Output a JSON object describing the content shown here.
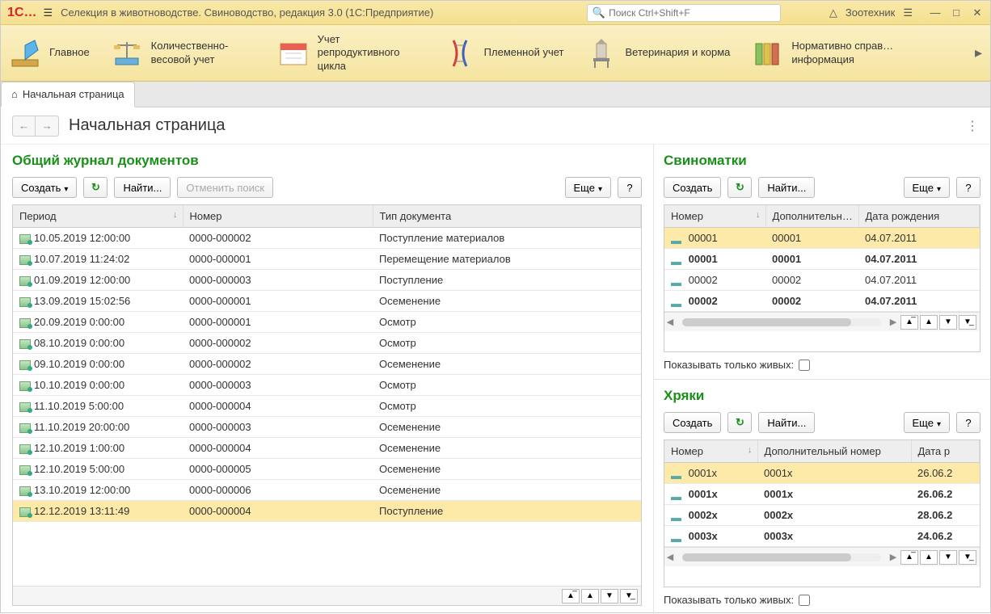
{
  "titlebar": {
    "app_title": "Селекция в животноводстве. Свиноводство, редакция 3.0  (1С:Предприятие)",
    "search_placeholder": "Поиск Ctrl+Shift+F",
    "user": "Зоотехник"
  },
  "nav": {
    "items": [
      {
        "label": "Главное"
      },
      {
        "label": "Количественно-весовой учет"
      },
      {
        "label": "Учет репродуктивного цикла"
      },
      {
        "label": "Племенной учет"
      },
      {
        "label": "Ветеринария и корма"
      },
      {
        "label": "Нормативно справ…\nинформация"
      }
    ]
  },
  "tab": {
    "label": "Начальная страница"
  },
  "page": {
    "title": "Начальная страница"
  },
  "journal": {
    "title": "Общий журнал документов",
    "create": "Создать",
    "find": "Найти...",
    "cancel_search": "Отменить поиск",
    "more": "Еще",
    "cols": {
      "period": "Период",
      "number": "Номер",
      "type": "Тип документа"
    },
    "rows": [
      {
        "period": "10.05.2019 12:00:00",
        "number": "0000-000002",
        "type": "Поступление материалов"
      },
      {
        "period": "10.07.2019 11:24:02",
        "number": "0000-000001",
        "type": "Перемещение материалов"
      },
      {
        "period": "01.09.2019 12:00:00",
        "number": "0000-000003",
        "type": "Поступление"
      },
      {
        "period": "13.09.2019 15:02:56",
        "number": "0000-000001",
        "type": "Осеменение"
      },
      {
        "period": "20.09.2019 0:00:00",
        "number": "0000-000001",
        "type": "Осмотр"
      },
      {
        "period": "08.10.2019 0:00:00",
        "number": "0000-000002",
        "type": "Осмотр"
      },
      {
        "period": "09.10.2019 0:00:00",
        "number": "0000-000002",
        "type": "Осеменение"
      },
      {
        "period": "10.10.2019 0:00:00",
        "number": "0000-000003",
        "type": "Осмотр"
      },
      {
        "period": "11.10.2019 5:00:00",
        "number": "0000-000004",
        "type": "Осмотр"
      },
      {
        "period": "11.10.2019 20:00:00",
        "number": "0000-000003",
        "type": "Осеменение"
      },
      {
        "period": "12.10.2019 1:00:00",
        "number": "0000-000004",
        "type": "Осеменение"
      },
      {
        "period": "12.10.2019 5:00:00",
        "number": "0000-000005",
        "type": "Осеменение"
      },
      {
        "period": "13.10.2019 12:00:00",
        "number": "0000-000006",
        "type": "Осеменение"
      },
      {
        "period": "12.12.2019 13:11:49",
        "number": "0000-000004",
        "type": "Поступление",
        "selected": true
      }
    ]
  },
  "sows": {
    "title": "Свиноматки",
    "create": "Создать",
    "find": "Найти...",
    "more": "Еще",
    "cols": {
      "number": "Номер",
      "add": "Дополнительн…",
      "dob": "Дата рождения"
    },
    "rows": [
      {
        "number": "00001",
        "add": "00001",
        "dob": "04.07.2011",
        "selected": true
      },
      {
        "number": "00001",
        "add": "00001",
        "dob": "04.07.2011",
        "bold": true
      },
      {
        "number": "00002",
        "add": "00002",
        "dob": "04.07.2011"
      },
      {
        "number": "00002",
        "add": "00002",
        "dob": "04.07.2011",
        "bold": true
      }
    ],
    "alive_label": "Показывать только живых:"
  },
  "boars": {
    "title": "Хряки",
    "create": "Создать",
    "find": "Найти...",
    "more": "Еще",
    "cols": {
      "number": "Номер",
      "add": "Дополнительный номер",
      "dob": "Дата р"
    },
    "rows": [
      {
        "number": "0001x",
        "add": "0001x",
        "dob": "26.06.2",
        "selected": true
      },
      {
        "number": "0001x",
        "add": "0001x",
        "dob": "26.06.2",
        "bold": true
      },
      {
        "number": "0002x",
        "add": "0002x",
        "dob": "28.06.2",
        "bold": true
      },
      {
        "number": "0003x",
        "add": "0003x",
        "dob": "24.06.2",
        "bold": true
      }
    ],
    "alive_label": "Показывать только живых:"
  }
}
